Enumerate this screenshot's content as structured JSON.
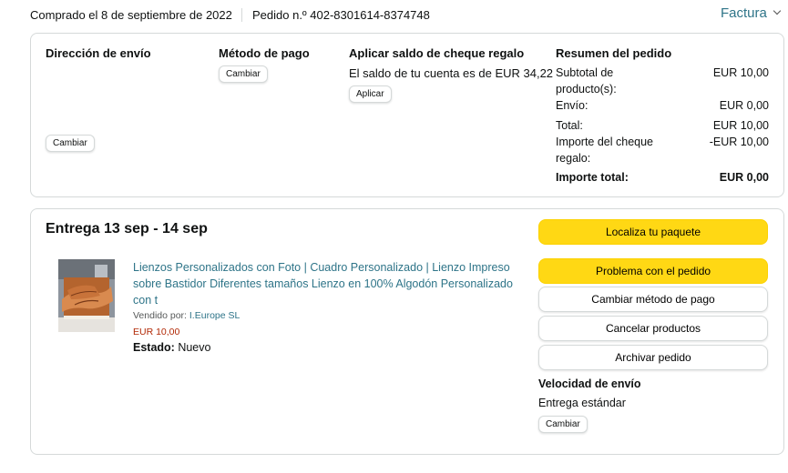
{
  "header": {
    "purchase_date": "Comprado el 8 de septiembre de 2022",
    "order_number": "Pedido n.º 402-8301614-8374748",
    "invoice_label": "Factura"
  },
  "summary": {
    "shipping_address": {
      "title": "Dirección de envío",
      "button": "Cambiar"
    },
    "payment_method": {
      "title": "Método de pago",
      "button": "Cambiar"
    },
    "gift_card": {
      "title": "Aplicar saldo de cheque regalo",
      "balance_text": "El saldo de tu cuenta es de EUR 34,22",
      "button": "Aplicar"
    },
    "order_summary": {
      "title": "Resumen del pedido",
      "rows": [
        {
          "label": "Subtotal de producto(s):",
          "value": "EUR 10,00"
        },
        {
          "label": "Envío:",
          "value": "EUR 0,00"
        },
        {
          "label": "Total:",
          "value": "EUR 10,00"
        },
        {
          "label": "Importe del cheque regalo:",
          "value": "-EUR 10,00"
        },
        {
          "label": "Importe total:",
          "value": "EUR 0,00"
        }
      ]
    }
  },
  "delivery": {
    "title": "Entrega 13 sep - 14 sep",
    "product": {
      "title": "Lienzos Personalizados con Foto | Cuadro Personalizado | Lienzo Impreso sobre Bastidor Diferentes tamaños Lienzo en 100% Algodón Personalizado con t",
      "seller_prefix": "Vendido por:",
      "seller_name": "I.Europe SL",
      "price": "EUR 10,00",
      "status_label": "Estado:",
      "status_value": "Nuevo"
    },
    "actions": {
      "track": "Localiza tu paquete",
      "problem": "Problema con el pedido",
      "change_payment": "Cambiar método de pago",
      "cancel": "Cancelar productos",
      "archive": "Archivar pedido"
    },
    "shipping_speed": {
      "title": "Velocidad de envío",
      "value": "Entrega estándar",
      "button": "Cambiar"
    }
  },
  "colors": {
    "accent_link": "#2e7488",
    "primary_button": "#ffd814",
    "price": "#b12704",
    "border": "#d5d9d9"
  }
}
